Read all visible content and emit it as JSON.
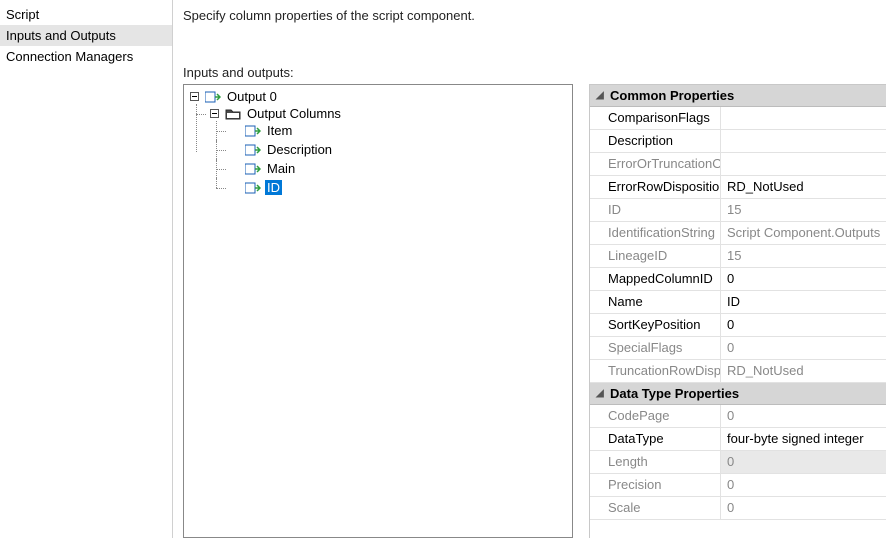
{
  "sidebar": {
    "items": [
      {
        "label": "Script"
      },
      {
        "label": "Inputs and Outputs"
      },
      {
        "label": "Connection Managers"
      }
    ]
  },
  "heading": "Specify column properties of the script component.",
  "io_label": "Inputs and outputs:",
  "tree": {
    "root": {
      "label": "Output 0"
    },
    "folder": {
      "label": "Output Columns"
    },
    "cols": [
      {
        "label": "Item"
      },
      {
        "label": "Description"
      },
      {
        "label": "Main"
      },
      {
        "label": "ID"
      }
    ]
  },
  "props": {
    "section1": "Common Properties",
    "section2": "Data Type Properties",
    "rows1": [
      {
        "name": "ComparisonFlags",
        "value": "",
        "dim": false
      },
      {
        "name": "Description",
        "value": "",
        "dim": false
      },
      {
        "name": "ErrorOrTruncationOperation",
        "value": "",
        "dim": true
      },
      {
        "name": "ErrorRowDisposition",
        "value": "RD_NotUsed",
        "dim": false
      },
      {
        "name": "ID",
        "value": "15",
        "dim": true
      },
      {
        "name": "IdentificationString",
        "value": "Script Component.Outputs",
        "dim": true
      },
      {
        "name": "LineageID",
        "value": "15",
        "dim": true
      },
      {
        "name": "MappedColumnID",
        "value": "0",
        "dim": false
      },
      {
        "name": "Name",
        "value": "ID",
        "dim": false
      },
      {
        "name": "SortKeyPosition",
        "value": "0",
        "dim": false
      },
      {
        "name": "SpecialFlags",
        "value": "0",
        "dim": true
      },
      {
        "name": "TruncationRowDisposition",
        "value": "RD_NotUsed",
        "dim": true
      }
    ],
    "rows2": [
      {
        "name": "CodePage",
        "value": "0",
        "dim": true
      },
      {
        "name": "DataType",
        "value": "four-byte signed integer",
        "dim": false
      },
      {
        "name": "Length",
        "value": "0",
        "dim": true,
        "greybg": true
      },
      {
        "name": "Precision",
        "value": "0",
        "dim": true
      },
      {
        "name": "Scale",
        "value": "0",
        "dim": true
      }
    ]
  }
}
